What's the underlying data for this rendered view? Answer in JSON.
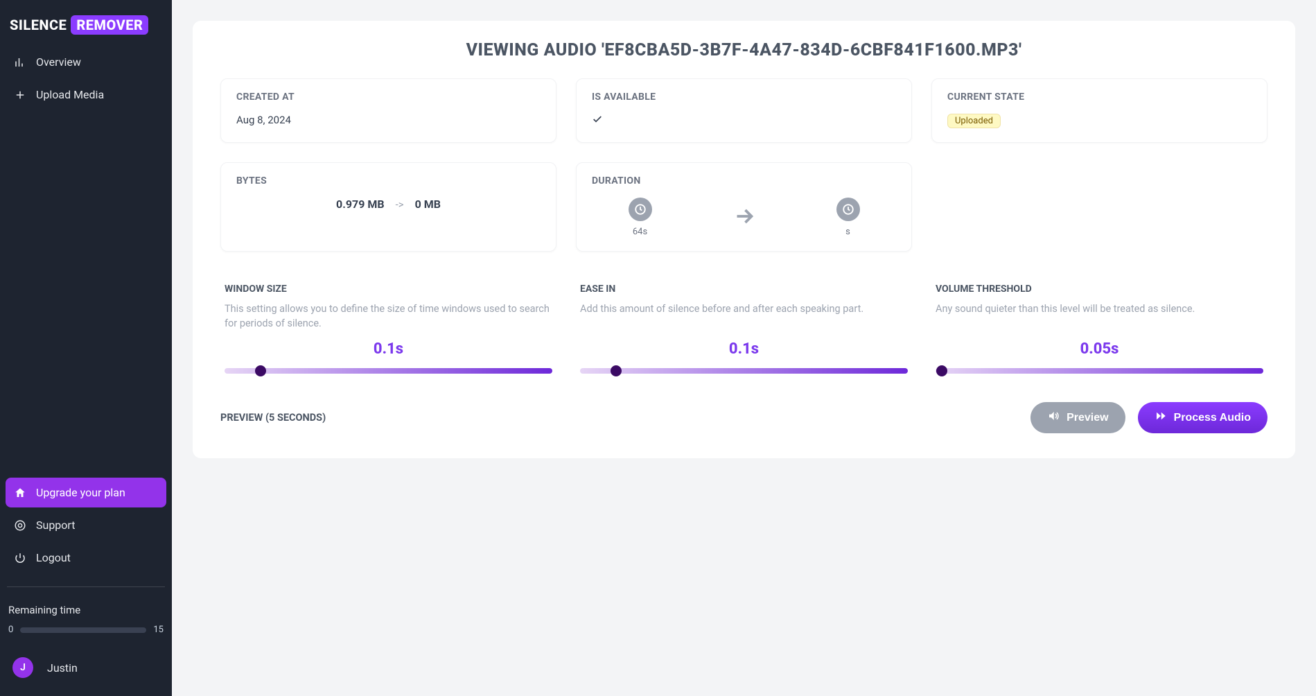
{
  "sidebar": {
    "logo_first": "SILENCE",
    "logo_second": "REMOVER",
    "nav_top": [
      {
        "label": "Overview"
      },
      {
        "label": "Upload Media"
      }
    ],
    "nav_bottom": {
      "upgrade": "Upgrade your plan",
      "support": "Support",
      "logout": "Logout"
    },
    "remaining_title": "Remaining time",
    "remaining_min": "0",
    "remaining_max": "15",
    "remaining_pct": 0,
    "user_name": "Justin",
    "user_initial": "J"
  },
  "page": {
    "title": "VIEWING AUDIO 'EF8CBA5D-3B7F-4A47-834D-6CBF841F1600.MP3'",
    "created_at_label": "CREATED AT",
    "created_at_value": "Aug 8, 2024",
    "available_label": "IS AVAILABLE",
    "state_label": "CURRENT STATE",
    "state_value": "Uploaded",
    "bytes_label": "BYTES",
    "bytes_before": "0.979 MB",
    "bytes_arrow": "->",
    "bytes_after": "0 MB",
    "duration_label": "DURATION",
    "duration_before": "64s",
    "duration_after": "s",
    "preview_label": "PREVIEW (5 SECONDS)",
    "preview_btn": "Preview",
    "process_btn": "Process Audio"
  },
  "settings": {
    "window": {
      "title": "WINDOW SIZE",
      "desc": "This setting allows you to define the size of time windows used to search for periods of silence.",
      "value": "0.1s",
      "pct": 11
    },
    "ease": {
      "title": "EASE IN",
      "desc": "Add this amount of silence before and after each speaking part.",
      "value": "0.1s",
      "pct": 11
    },
    "threshold": {
      "title": "VOLUME THRESHOLD",
      "desc": "Any sound quieter than this level will be treated as silence.",
      "value": "0.05s",
      "pct": 2
    }
  }
}
